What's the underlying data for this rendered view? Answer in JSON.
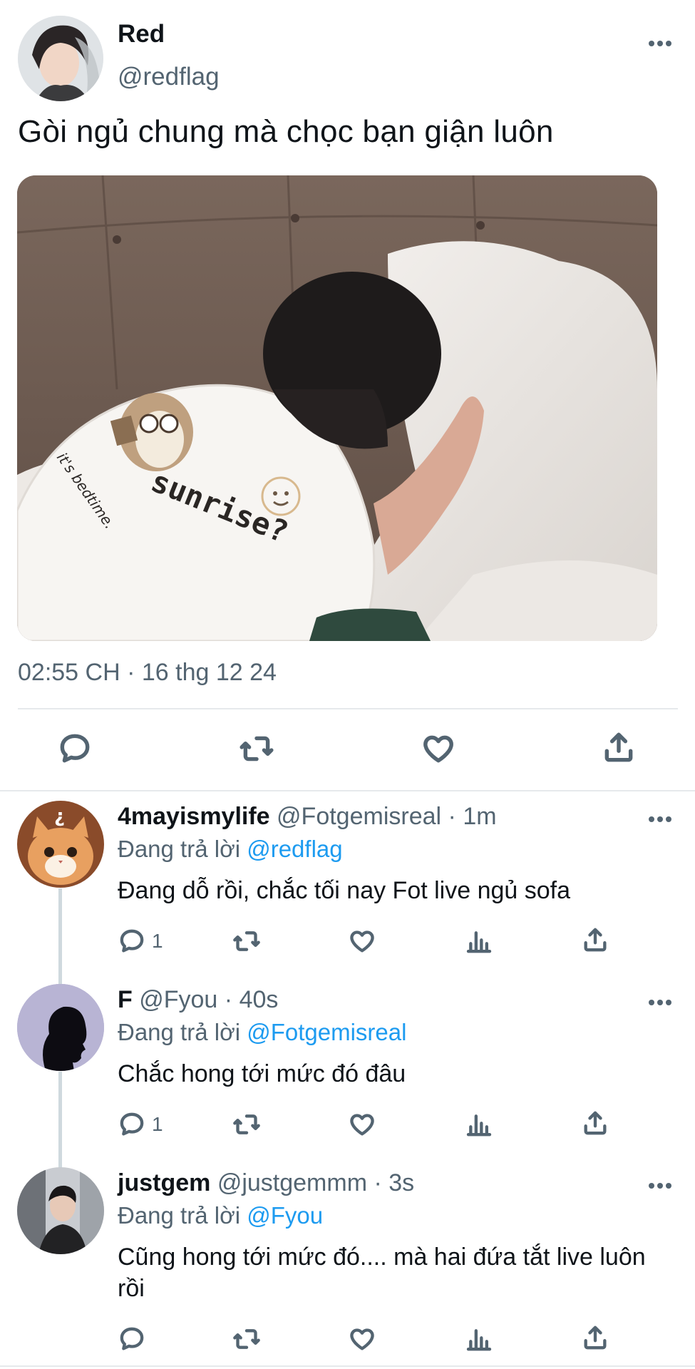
{
  "main_tweet": {
    "author_name": "Red",
    "author_handle": "@redflag",
    "text": "Gòi ngủ chung mà chọc bạn giận luôn",
    "media_caption": {
      "left_print": "it's bedtime.",
      "right_print": "sunrise?"
    },
    "timestamp": "02:55 CH · 16 thg 12 24",
    "actions": [
      "reply-icon",
      "retweet-icon",
      "like-icon",
      "share-icon"
    ]
  },
  "replies": [
    {
      "name": "4mayismylife",
      "handle": "@Fotgemisreal",
      "dot": "·",
      "time": "1m",
      "replying_prefix": "Đang trả lời",
      "replying_to": "@redflag",
      "text": "Đang dỗ rồi, chắc tối nay Fot live ngủ sofa",
      "reply_count": "1"
    },
    {
      "name": "F",
      "handle": "@Fyou",
      "dot": "·",
      "time": "40s",
      "replying_prefix": "Đang trả lời",
      "replying_to": "@Fotgemisreal",
      "text": "Chắc hong tới mức đó đâu",
      "reply_count": "1"
    },
    {
      "name": "justgem",
      "handle": "@justgemmm",
      "dot": "·",
      "time": "3s",
      "replying_prefix": "Đang trả lời",
      "replying_to": "@Fyou",
      "text": "Cũng hong tới mức đó.... mà hai đứa tắt live luôn rồi",
      "reply_count": ""
    }
  ],
  "colors": {
    "text": "#0f1419",
    "secondary": "#536471",
    "link": "#1d9bf0",
    "divider": "#e6e9ec"
  }
}
